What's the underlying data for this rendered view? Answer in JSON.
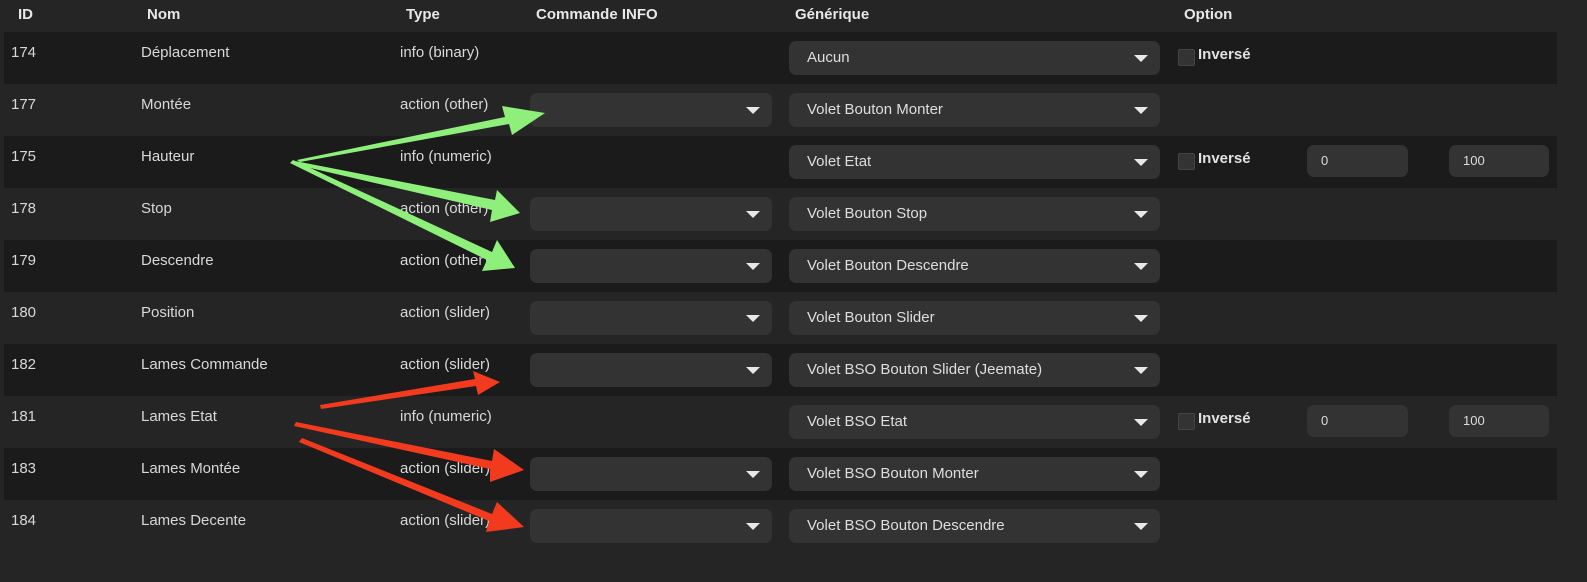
{
  "headers": {
    "id": "ID",
    "nom": "Nom",
    "type": "Type",
    "commande_info": "Commande INFO",
    "generique": "Générique",
    "option": "Option"
  },
  "rows": [
    {
      "id": "174",
      "nom": "Déplacement",
      "type": "info (binary)",
      "has_commande": false,
      "generique": "Aucun",
      "inverse_label": "Inversé",
      "min": "",
      "max": ""
    },
    {
      "id": "177",
      "nom": "Montée",
      "type": "action (other)",
      "has_commande": true,
      "generique": "Volet Bouton Monter"
    },
    {
      "id": "175",
      "nom": "Hauteur",
      "type": "info (numeric)",
      "has_commande": false,
      "generique": "Volet Etat",
      "inverse_label": "Inversé",
      "min": "0",
      "max": "100"
    },
    {
      "id": "178",
      "nom": "Stop",
      "type": "action (other)",
      "has_commande": true,
      "generique": "Volet Bouton Stop"
    },
    {
      "id": "179",
      "nom": "Descendre",
      "type": "action (other)",
      "has_commande": true,
      "generique": "Volet Bouton Descendre"
    },
    {
      "id": "180",
      "nom": "Position",
      "type": "action (slider)",
      "has_commande": true,
      "generique": "Volet Bouton Slider"
    },
    {
      "id": "182",
      "nom": "Lames Commande",
      "type": "action (slider)",
      "has_commande": true,
      "generique": "Volet BSO Bouton Slider (Jeemate)"
    },
    {
      "id": "181",
      "nom": "Lames Etat",
      "type": "info (numeric)",
      "has_commande": false,
      "generique": "Volet BSO Etat",
      "inverse_label": "Inversé",
      "min": "0",
      "max": "100"
    },
    {
      "id": "183",
      "nom": "Lames Montée",
      "type": "action (slider)",
      "has_commande": true,
      "generique": "Volet BSO Bouton Monter"
    },
    {
      "id": "184",
      "nom": "Lames Decente",
      "type": "action (slider)",
      "has_commande": true,
      "generique": "Volet BSO Bouton Descendre"
    }
  ],
  "colors": {
    "green_arrow": "#8ef07a",
    "red_arrow": "#f23a1e"
  }
}
